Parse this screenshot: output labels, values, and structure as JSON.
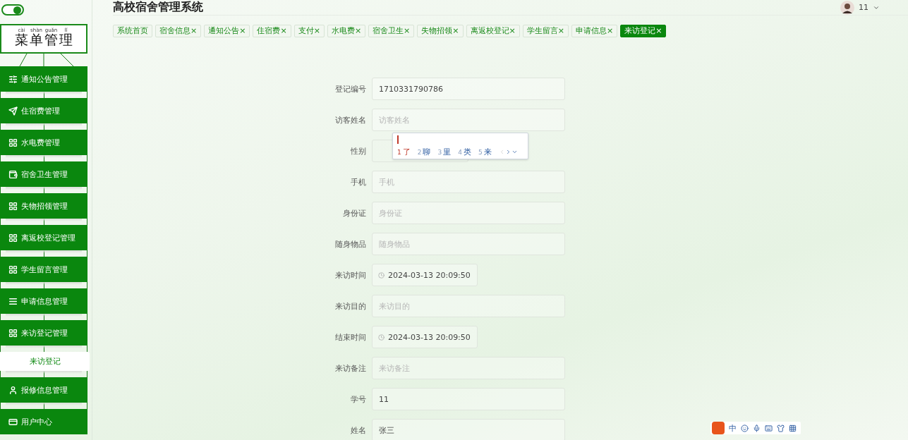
{
  "sidebar": {
    "toggle": {
      "on": true
    },
    "menu_title": [
      {
        "text": "菜",
        "pinyin": "cài"
      },
      {
        "text": "单",
        "pinyin": "shàn"
      },
      {
        "text": "管",
        "pinyin": "guǎn"
      },
      {
        "text": "理",
        "pinyin": "lǐ"
      }
    ],
    "items": [
      {
        "kind": "group",
        "label": "通知公告管理"
      },
      {
        "kind": "group",
        "label": "住宿费管理"
      },
      {
        "kind": "group",
        "label": "水电费管理"
      },
      {
        "kind": "group",
        "label": "宿舍卫生管理"
      },
      {
        "kind": "group",
        "label": "失物招领管理"
      },
      {
        "kind": "group",
        "label": "离返校登记管理"
      },
      {
        "kind": "group",
        "label": "学生留言管理"
      },
      {
        "kind": "group",
        "label": "申请信息管理"
      },
      {
        "kind": "group",
        "label": "来访登记管理"
      },
      {
        "kind": "sub",
        "label": "来访登记"
      },
      {
        "kind": "group",
        "label": "报修信息管理"
      },
      {
        "kind": "group",
        "label": "用户中心"
      }
    ]
  },
  "header": {
    "title": "高校宿舍管理系统",
    "user": "11"
  },
  "tabs": [
    {
      "label": "系统首页",
      "closable": false,
      "selected": false
    },
    {
      "label": "宿舍信息",
      "closable": true,
      "selected": false
    },
    {
      "label": "通知公告",
      "closable": true,
      "selected": false
    },
    {
      "label": "住宿费",
      "closable": true,
      "selected": false
    },
    {
      "label": "支付",
      "closable": true,
      "selected": false
    },
    {
      "label": "水电费",
      "closable": true,
      "selected": false
    },
    {
      "label": "宿舍卫生",
      "closable": true,
      "selected": false
    },
    {
      "label": "失物招领",
      "closable": true,
      "selected": false
    },
    {
      "label": "离返校登记",
      "closable": true,
      "selected": false
    },
    {
      "label": "学生留言",
      "closable": true,
      "selected": false
    },
    {
      "label": "申请信息",
      "closable": true,
      "selected": false
    },
    {
      "label": "来访登记",
      "closable": true,
      "selected": true
    }
  ],
  "close_mark": "×",
  "form": [
    {
      "kind": "text",
      "label": "登记编号",
      "value": "1710331790786"
    },
    {
      "kind": "text",
      "label": "访客姓名",
      "placeholder": "访客姓名"
    },
    {
      "kind": "select",
      "label": "性别"
    },
    {
      "kind": "text",
      "label": "手机",
      "placeholder": "手机"
    },
    {
      "kind": "text",
      "label": "身份证",
      "placeholder": "身份证"
    },
    {
      "kind": "text",
      "label": "随身物品",
      "placeholder": "随身物品"
    },
    {
      "kind": "date",
      "label": "来访时间",
      "value": "2024-03-13 20:09:50"
    },
    {
      "kind": "text",
      "label": "来访目的",
      "placeholder": "来访目的"
    },
    {
      "kind": "date",
      "label": "结束时间",
      "value": "2024-03-13 20:09:50"
    },
    {
      "kind": "text",
      "label": "来访备注",
      "placeholder": "来访备注"
    },
    {
      "kind": "text",
      "label": "学号",
      "value": "11"
    },
    {
      "kind": "text",
      "label": "姓名",
      "value": "张三"
    }
  ],
  "ime_popup": {
    "candidates": [
      {
        "index": "1",
        "char": "了",
        "selected": true
      },
      {
        "index": "2",
        "char": "聊",
        "selected": false
      },
      {
        "index": "3",
        "char": "里",
        "selected": false
      },
      {
        "index": "4",
        "char": "类",
        "selected": false
      },
      {
        "index": "5",
        "char": "来",
        "selected": false
      }
    ]
  },
  "ime_bar": {
    "mode": "中"
  }
}
